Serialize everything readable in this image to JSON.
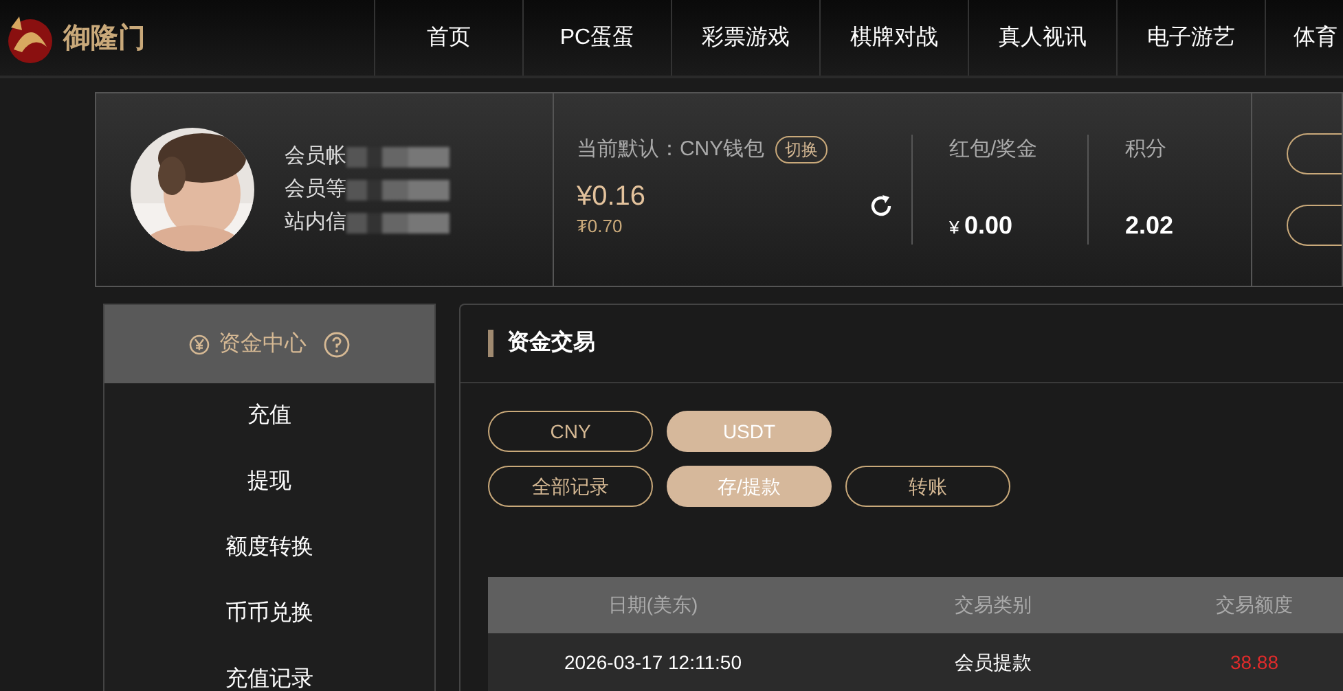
{
  "logo": {
    "text": "御隆门"
  },
  "nav": {
    "items": [
      "首页",
      "PC蛋蛋",
      "彩票游戏",
      "棋牌对战",
      "真人视讯",
      "电子游艺",
      "体育"
    ]
  },
  "profile": {
    "labels": [
      "会员帐",
      "会员等",
      "站内信"
    ]
  },
  "wallet": {
    "default_label": "当前默认：CNY钱包",
    "switch": "切换",
    "balance": "¥0.16",
    "sub_balance": "₮0.70"
  },
  "bonus": {
    "label": "红包/奖金",
    "currency": "¥",
    "value": "0.00"
  },
  "points": {
    "label": "积分",
    "value": "2.02"
  },
  "sidebar": {
    "title": "资金中心",
    "items": [
      "充值",
      "提现",
      "额度转换",
      "币币兑换",
      "充值记录"
    ]
  },
  "main": {
    "title": "资金交易",
    "currency_tabs": [
      {
        "label": "CNY",
        "selected": false
      },
      {
        "label": "USDT",
        "selected": true
      }
    ],
    "record_tabs": [
      {
        "label": "全部记录",
        "selected": false
      },
      {
        "label": "存/提款",
        "selected": true
      },
      {
        "label": "转账",
        "selected": false
      }
    ],
    "table": {
      "columns": [
        "日期(美东)",
        "交易类别",
        "交易额度"
      ],
      "rows": [
        {
          "cells": [
            "2026-03-17 12:11:50",
            "会员提款",
            "38.88"
          ]
        }
      ]
    }
  }
}
